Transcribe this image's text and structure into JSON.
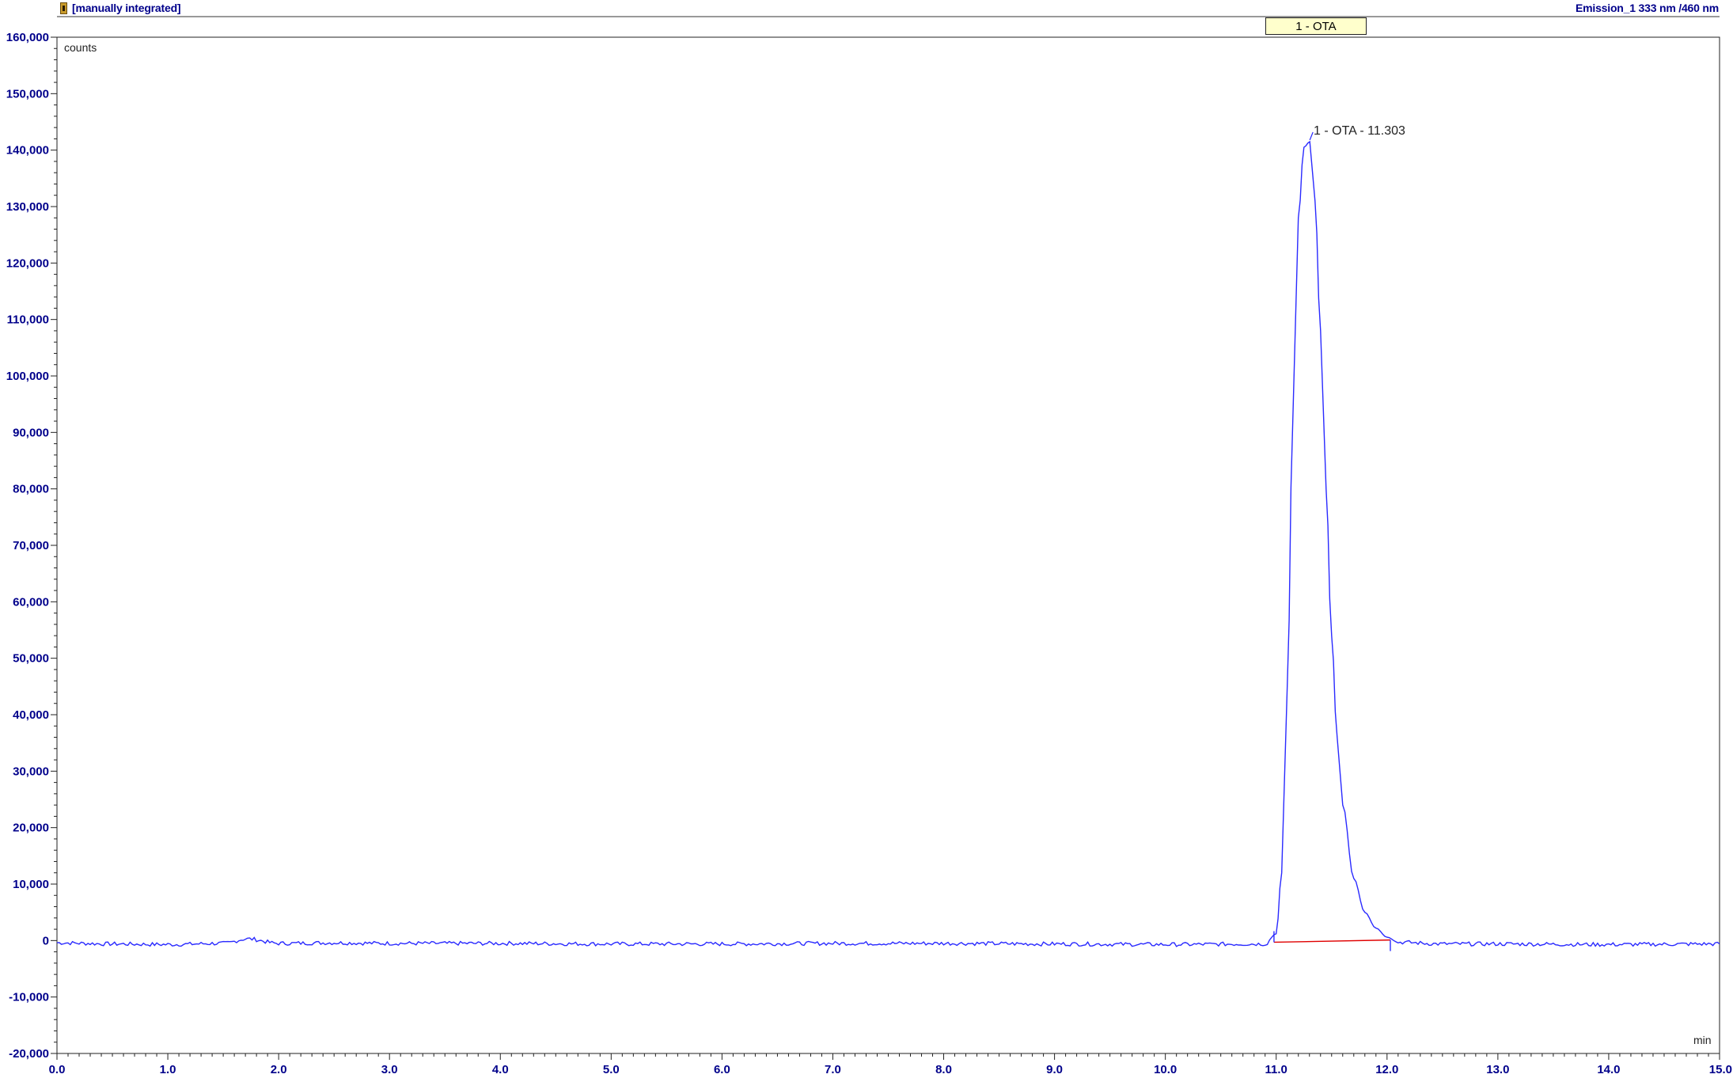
{
  "header": {
    "left_text": "[manually integrated]",
    "right_text": "Emission_1 333 nm /460 nm",
    "flag_icon": "integration-flag-icon"
  },
  "peak_box": {
    "label": "1 - OTA"
  },
  "chart_data": {
    "type": "line",
    "title": "",
    "xlabel": "min",
    "ylabel": "counts",
    "xlim": [
      0.0,
      15.0
    ],
    "ylim": [
      -20000,
      160000
    ],
    "x_ticks": [
      "0.0",
      "1.0",
      "2.0",
      "3.0",
      "4.0",
      "5.0",
      "6.0",
      "7.0",
      "8.0",
      "9.0",
      "10.0",
      "11.0",
      "12.0",
      "13.0",
      "14.0",
      "15.0"
    ],
    "y_ticks": [
      "160,000",
      "150,000",
      "140,000",
      "130,000",
      "120,000",
      "110,000",
      "100,000",
      "90,000",
      "80,000",
      "70,000",
      "60,000",
      "50,000",
      "40,000",
      "30,000",
      "20,000",
      "10,000",
      "0",
      "-10,000",
      "-20,000"
    ],
    "grid": false,
    "colors": {
      "trace": "#2a2aff",
      "baseline": "#e00000",
      "axis_text": "#00008b"
    },
    "series": [
      {
        "values_x": [
          0.0,
          0.5,
          1.0,
          1.5,
          1.72,
          2.0,
          2.5,
          3.0,
          4.0,
          5.0,
          6.0,
          7.0,
          8.0,
          9.0,
          10.0,
          10.9,
          11.0,
          11.05,
          11.1,
          11.15,
          11.2,
          11.25,
          11.303,
          11.35,
          11.4,
          11.45,
          11.5,
          11.55,
          11.6,
          11.7,
          11.8,
          11.9,
          12.0,
          12.1,
          12.5,
          13.0,
          14.0,
          15.0
        ],
        "values_y": [
          -400,
          -600,
          -700,
          -500,
          300,
          -500,
          -400,
          -500,
          -500,
          -600,
          -600,
          -500,
          -500,
          -600,
          -700,
          -600,
          1200,
          12000,
          45000,
          92000,
          128000,
          140500,
          141500,
          131000,
          108000,
          80000,
          54000,
          36000,
          24000,
          11000,
          5000,
          2200,
          600,
          -300,
          -600,
          -600,
          -700,
          -600
        ]
      }
    ],
    "baseline": {
      "x": [
        10.98,
        12.03
      ],
      "y": [
        -300,
        100
      ]
    },
    "peak": {
      "label": "1 - OTA - 11.303",
      "x": 11.303,
      "y": 141500
    }
  }
}
